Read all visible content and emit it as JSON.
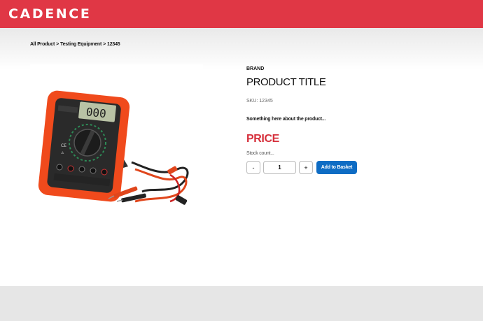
{
  "header": {
    "logo": "CADENCE",
    "background": "#e03745"
  },
  "breadcrumb": [
    "All Product",
    ">",
    "Testing Equipment",
    ">",
    "12345"
  ],
  "product": {
    "brand": "BRAND",
    "title": "PRODUCT TITLE",
    "sku": "SKU: 12345",
    "description": "Something here about the product...",
    "price": "PRICE",
    "stock": "Stock count...",
    "quantity": "1",
    "image_alt": "digital multimeter with test leads"
  },
  "buttons": {
    "minus": "-",
    "plus": "+",
    "add_to_basket": "Add to Basket"
  },
  "colors": {
    "accent": "#e03745",
    "price": "#d6303c",
    "button": "#0e6cc4"
  }
}
